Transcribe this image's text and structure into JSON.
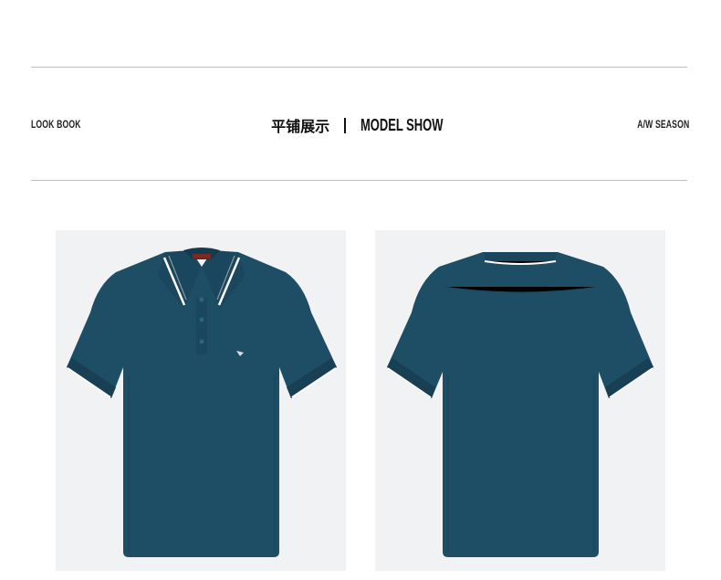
{
  "header": {
    "left_label": "LOOK BOOK",
    "center_cn": "平铺展示",
    "center_en": "MODEL SHOW",
    "right_label": "A/W SEASON"
  },
  "products": [
    {
      "view": "front",
      "color": "#1d4e66"
    },
    {
      "view": "back",
      "color": "#1d4e66"
    }
  ]
}
